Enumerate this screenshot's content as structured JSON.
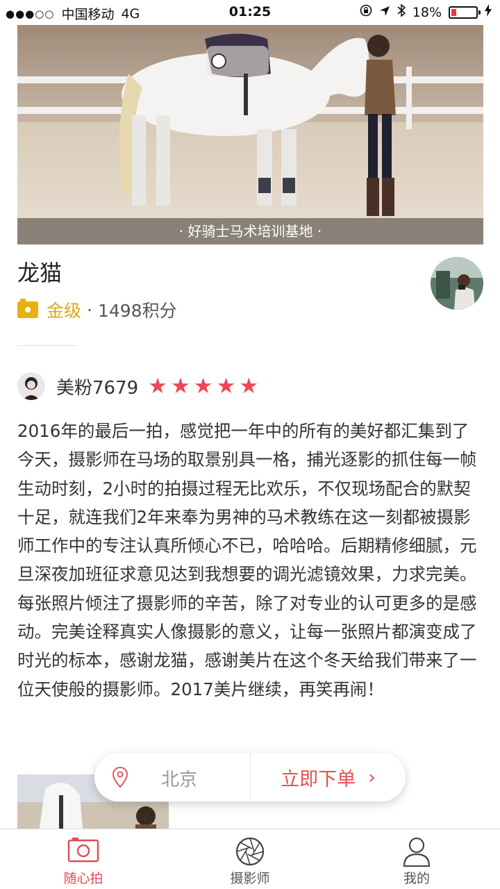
{
  "status_bar": {
    "carrier": "中国移动",
    "network": "4G",
    "time": "01:25",
    "battery": "18%",
    "battery_level": 0.18,
    "icons": [
      "signal-dots-icon",
      "lock-rotation-icon",
      "location-arrow-icon",
      "bluetooth-icon",
      "battery-icon",
      "charging-icon"
    ]
  },
  "hero": {
    "caption": "· 好骑士马术培训基地 ·"
  },
  "profile": {
    "name": "龙猫",
    "level": "金级",
    "separator": "·",
    "points": "1498积分"
  },
  "review": {
    "reviewer": "美粉7679",
    "rating": 5,
    "text": "2016年的最后一拍，感觉把一年中的所有的美好都汇集到了今天，摄影师在马场的取景别具一格，捕光逐影的抓住每一帧生动时刻，2小时的拍摄过程无比欢乐，不仅现场配合的默契十足，就连我们2年来奉为男神的马术教练在这一刻都被摄影师工作中的专注认真所倾心不已，哈哈哈。后期精修细腻，元旦深夜加班征求意见达到我想要的调光滤镜效果，力求完美。每张照片倾注了摄影师的辛苦，除了对专业的认可更多的是感动。完美诠释真实人像摄影的意义，让每一张照片都演变成了时光的标本，感谢龙猫，感谢美片在这个冬天给我们带来了一位天使般的摄影师。2017美片继续，再笑再闹！"
  },
  "floating_bar": {
    "city": "北京",
    "order_label": "立即下单",
    "order_arrow": "›"
  },
  "tabs": [
    {
      "label": "随心拍",
      "icon": "camera-icon",
      "active": true
    },
    {
      "label": "摄影师",
      "icon": "aperture-icon",
      "active": false
    },
    {
      "label": "我的",
      "icon": "user-icon",
      "active": false
    }
  ],
  "colors": {
    "accent": "#e14b55",
    "star": "#ef4754",
    "gold": "#d8ab1a",
    "battery_low": "#e63b3b"
  }
}
